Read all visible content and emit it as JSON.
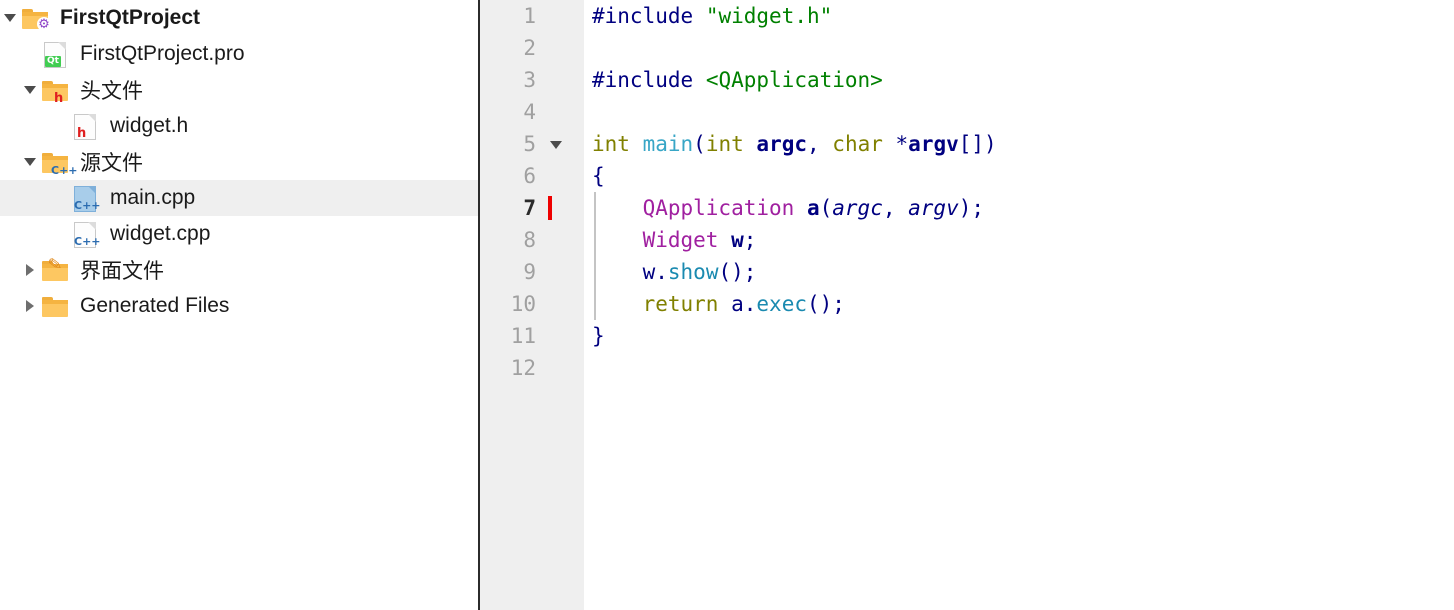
{
  "project_tree": {
    "name": "project-file-tree",
    "items": [
      {
        "label": "FirstQtProject",
        "icon": "folder-project-icon",
        "expander": "expanded",
        "depth": 0,
        "bold": true,
        "selected": false
      },
      {
        "label": "FirstQtProject.pro",
        "icon": "file-qt-pro-icon",
        "expander": "none",
        "depth": 1,
        "bold": false,
        "selected": false
      },
      {
        "label": "头文件",
        "icon": "folder-headers-icon",
        "expander": "expanded",
        "depth": 1,
        "bold": false,
        "selected": false
      },
      {
        "label": "widget.h",
        "icon": "file-header-icon",
        "expander": "none",
        "depth": 2,
        "bold": false,
        "selected": false
      },
      {
        "label": "源文件",
        "icon": "folder-sources-icon",
        "expander": "expanded",
        "depth": 1,
        "bold": false,
        "selected": false
      },
      {
        "label": "main.cpp",
        "icon": "file-cpp-icon",
        "expander": "none",
        "depth": 2,
        "bold": false,
        "selected": true
      },
      {
        "label": "widget.cpp",
        "icon": "file-cpp-icon",
        "expander": "none",
        "depth": 2,
        "bold": false,
        "selected": false
      },
      {
        "label": "界面文件",
        "icon": "folder-forms-icon",
        "expander": "collapsed",
        "depth": 1,
        "bold": false,
        "selected": false
      },
      {
        "label": "Generated Files",
        "icon": "folder-plain-icon",
        "expander": "collapsed",
        "depth": 1,
        "bold": false,
        "selected": false
      }
    ]
  },
  "editor": {
    "open_file": "main.cpp",
    "current_line": 7,
    "cursor_line": 7,
    "fold_marker_line": 5,
    "line_numbers": [
      "1",
      "2",
      "3",
      "4",
      "5",
      "6",
      "7",
      "8",
      "9",
      "10",
      "11",
      "12"
    ],
    "lines": [
      {
        "n": "1",
        "text": "#include \"widget.h\""
      },
      {
        "n": "2",
        "text": ""
      },
      {
        "n": "3",
        "text": "#include <QApplication>"
      },
      {
        "n": "4",
        "text": ""
      },
      {
        "n": "5",
        "text": "int main(int argc, char *argv[])"
      },
      {
        "n": "6",
        "text": "{"
      },
      {
        "n": "7",
        "text": "    QApplication a(argc, argv);"
      },
      {
        "n": "8",
        "text": "    Widget w;"
      },
      {
        "n": "9",
        "text": "    w.show();"
      },
      {
        "n": "10",
        "text": "    return a.exec();"
      },
      {
        "n": "11",
        "text": "}"
      },
      {
        "n": "12",
        "text": ""
      }
    ],
    "tokens": {
      "l1_include": "#include",
      "l1_string": "\"widget.h\"",
      "l3_include": "#include",
      "l3_string": "<QApplication>",
      "l5_int": "int",
      "l5_main": "main",
      "l5_paren_open": "(",
      "l5_int2": "int",
      "l5_argc": "argc",
      "l5_comma": ", ",
      "l5_char": "char",
      "l5_star": " *",
      "l5_argv": "argv",
      "l5_brackets": "[])",
      "l6_brace": "{",
      "l7_class": "QApplication",
      "l7_var": "a",
      "l7_open": "(",
      "l7_argc": "argc",
      "l7_comma": ", ",
      "l7_argv": "argv",
      "l7_close": ");",
      "l8_class": "Widget",
      "l8_var": "w",
      "l8_semi": ";",
      "l9_var": "w",
      "l9_dot": ".",
      "l9_fn": "show",
      "l9_tail": "();",
      "l10_return": "return",
      "l10_var": "a",
      "l10_dot": ".",
      "l10_fn": "exec",
      "l10_tail": "();",
      "l11_brace": "}"
    }
  },
  "colors": {
    "gutter_bg": "#efefef",
    "selection_bg": "#efefef",
    "divider": "#2b2b2b",
    "cursor": "#ee0000",
    "preprocessor": "#000080",
    "string": "#008000",
    "keyword_type": "#808000",
    "function": "#1a8ab0",
    "class_name": "#a020a0",
    "variable": "#000080",
    "line_number": "#a0a0a0",
    "folder": "#fdc761",
    "qt_badge": "#41cd52",
    "gear_badge": "#8e44c8"
  }
}
